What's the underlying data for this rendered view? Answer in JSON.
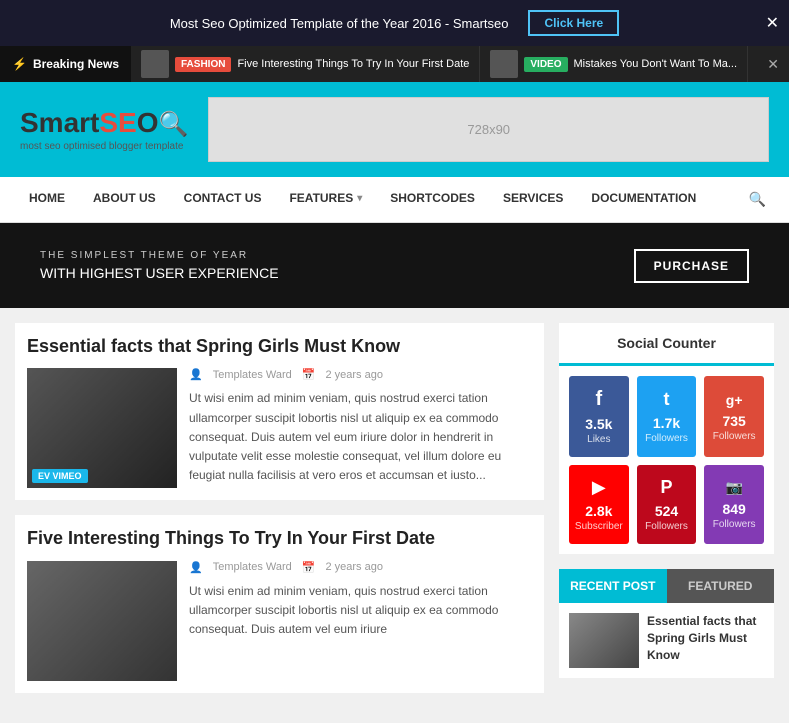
{
  "topbar": {
    "message": "Most Seo Optimized Template of the Year 2016 - Smartseo",
    "cta_label": "Click Here",
    "close_label": "✕"
  },
  "breaking": {
    "label": "Breaking News",
    "lightning": "⚡",
    "items": [
      {
        "badge": "FASHION",
        "badge_class": "badge-fashion",
        "text": "Five Interesting Things To Try In Your First Date"
      },
      {
        "badge": "VIDEO",
        "badge_class": "badge-video",
        "text": "Mistakes You Don't Want To Ma..."
      }
    ],
    "close": "✕"
  },
  "header": {
    "logo_smart": "Smart",
    "logo_seo": "SE",
    "logo_o": "O",
    "logo_tagline": "most seo optimised blogger template",
    "ad_text": "728x90"
  },
  "nav": {
    "items": [
      {
        "label": "HOME",
        "id": "home",
        "has_dropdown": false
      },
      {
        "label": "ABOUT US",
        "id": "about-us",
        "has_dropdown": false
      },
      {
        "label": "CONTACT US",
        "id": "contact-us",
        "has_dropdown": false
      },
      {
        "label": "FEATURES",
        "id": "features",
        "has_dropdown": true
      },
      {
        "label": "SHORTCODES",
        "id": "shortcodes",
        "has_dropdown": false
      },
      {
        "label": "SERVICES",
        "id": "services",
        "has_dropdown": false
      },
      {
        "label": "DOCUMENTATION",
        "id": "documentation",
        "has_dropdown": false
      }
    ],
    "search_icon": "🔍"
  },
  "hero": {
    "subtitle": "THE SIMPLEST THEME OF YEAR",
    "title": "WITH HIGHEST USER EXPERIENCE",
    "cta": "PURCHASE"
  },
  "articles": [
    {
      "title": "Essential facts that Spring Girls Must Know",
      "author": "Templates Ward",
      "date": "2 years ago",
      "vimeo_badge": "EV VIMEO",
      "text": "Ut wisi enim ad minim veniam, quis nostrud exerci tation ullamcorper suscipit lobortis nisl ut aliquip ex ea commodo consequat. Duis autem vel eum iriure dolor in hendrerit in vulputate velit esse molestie consequat, vel illum dolore eu feugiat nulla facilisis at vero eros et accumsan et iusto..."
    },
    {
      "title": "Five Interesting Things To Try In Your First Date",
      "author": "Templates Ward",
      "date": "2 years ago",
      "vimeo_badge": "",
      "text": "Ut wisi enim ad minim veniam, quis nostrud exerci tation ullamcorper suscipit lobortis nisl ut aliquip ex ea commodo consequat. Duis autem vel eum iriure"
    }
  ],
  "sidebar": {
    "social_counter": {
      "title": "Social Counter",
      "cards": [
        {
          "platform": "facebook",
          "icon": "f",
          "count": "3.5k",
          "label": "Likes",
          "class": "facebook"
        },
        {
          "platform": "twitter",
          "icon": "t",
          "count": "1.7k",
          "label": "Followers",
          "class": "twitter"
        },
        {
          "platform": "google",
          "icon": "g+",
          "count": "735",
          "label": "Followers",
          "class": "google"
        },
        {
          "platform": "youtube",
          "icon": "▶",
          "count": "2.8k",
          "label": "Subscriber",
          "class": "youtube"
        },
        {
          "platform": "pinterest",
          "icon": "P",
          "count": "524",
          "label": "Followers",
          "class": "pinterest"
        },
        {
          "platform": "instagram",
          "icon": "In",
          "count": "849",
          "label": "Followers",
          "class": "instagram"
        }
      ]
    },
    "tabs": {
      "recent_label": "RECENT POST",
      "featured_label": "FEATURED",
      "recent_article": "Essential facts that Spring Girls Must Know"
    }
  }
}
